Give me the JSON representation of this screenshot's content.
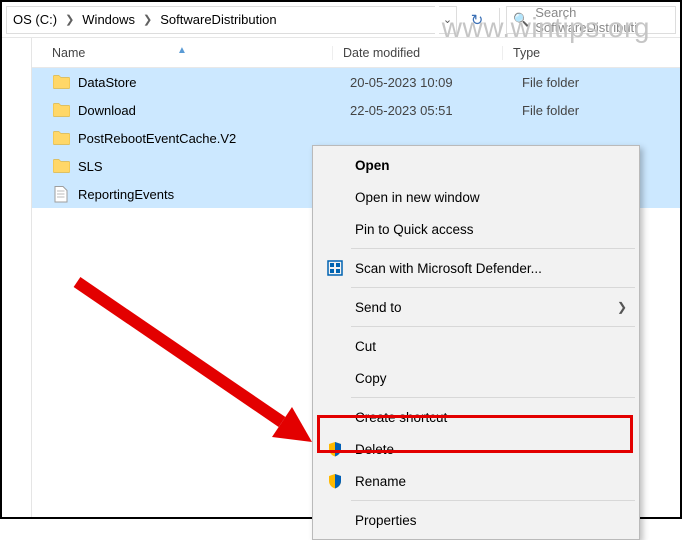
{
  "watermark": "www.wintips.org",
  "breadcrumb": {
    "parts": [
      "OS (C:)",
      "Windows",
      "SoftwareDistribution"
    ]
  },
  "search": {
    "placeholder": "Search SoftwareDistributi"
  },
  "columns": {
    "name": "Name",
    "date": "Date modified",
    "type": "Type"
  },
  "rows": [
    {
      "name": "DataStore",
      "date": "20-05-2023 10:09",
      "type": "File folder",
      "kind": "folder",
      "selected": true
    },
    {
      "name": "Download",
      "date": "22-05-2023 05:51",
      "type": "File folder",
      "kind": "folder",
      "selected": true
    },
    {
      "name": "PostRebootEventCache.V2",
      "date": "",
      "type": "",
      "kind": "folder",
      "selected": true
    },
    {
      "name": "SLS",
      "date": "",
      "type": "",
      "kind": "folder",
      "selected": true
    },
    {
      "name": "ReportingEvents",
      "date": "",
      "type": "",
      "kind": "file",
      "selected": true
    }
  ],
  "context": {
    "open": "Open",
    "open_new": "Open in new window",
    "pin_quick": "Pin to Quick access",
    "defender": "Scan with Microsoft Defender...",
    "send_to": "Send to",
    "cut": "Cut",
    "copy": "Copy",
    "shortcut": "Create shortcut",
    "delete": "Delete",
    "rename": "Rename",
    "properties": "Properties"
  }
}
